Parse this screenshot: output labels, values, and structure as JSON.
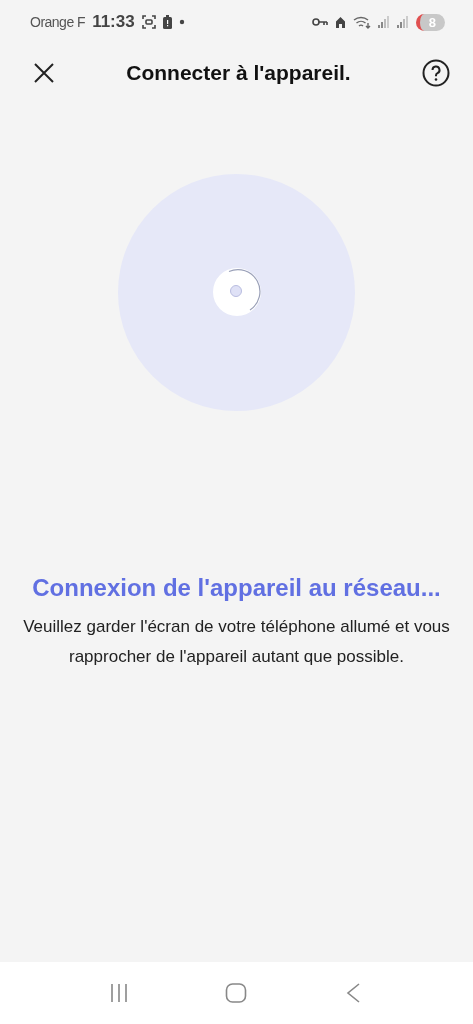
{
  "status_bar": {
    "carrier": "Orange F",
    "time": "11:33",
    "notification_count": "8"
  },
  "header": {
    "title": "Connecter à l'appareil."
  },
  "progress": {
    "title": "Connexion de l'appareil au réseau...",
    "message": "Veuillez garder l'écran de votre téléphone allumé et vous rapprocher de l'appareil autant que possible."
  }
}
